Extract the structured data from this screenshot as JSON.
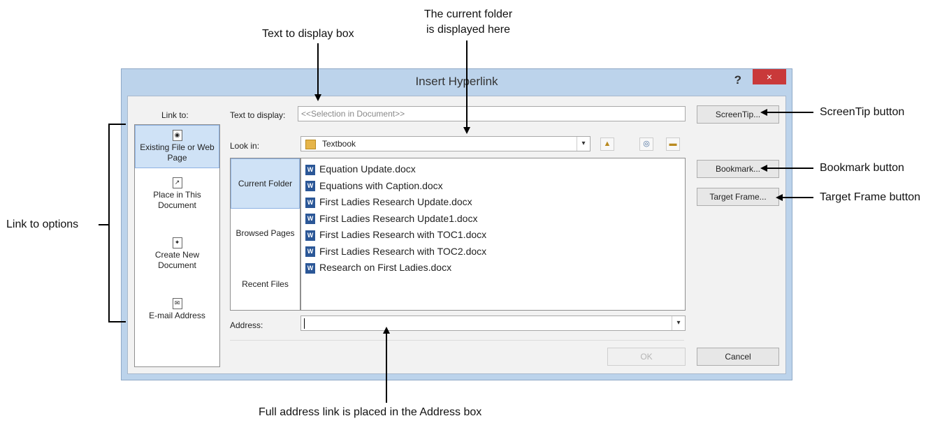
{
  "callouts": {
    "text_to_display": "Text to display box",
    "current_folder": "The current folder\nis displayed here",
    "screentip": "ScreenTip button",
    "bookmark": "Bookmark button",
    "target_frame": "Target Frame button",
    "link_to_options": "Link to options",
    "address": "Full address link is placed in the Address box"
  },
  "dialog": {
    "title": "Insert Hyperlink",
    "help": "?",
    "close": "×",
    "link_to_label": "Link to:",
    "link_items": [
      "Existing File or Web Page",
      "Place in This Document",
      "Create New Document",
      "E-mail Address"
    ],
    "text_to_display_label": "Text to display:",
    "text_to_display_value": "<<Selection in Document>>",
    "look_in_label": "Look in:",
    "look_in_value": "Textbook",
    "view_tabs": [
      "Current Folder",
      "Browsed Pages",
      "Recent Files"
    ],
    "files": [
      "Equation Update.docx",
      "Equations with Caption.docx",
      "First Ladies Research Update.docx",
      "First Ladies Research Update1.docx",
      "First Ladies Research with TOC1.docx",
      "First Ladies Research with TOC2.docx",
      "Research on First Ladies.docx"
    ],
    "address_label": "Address:",
    "address_value": "",
    "buttons": {
      "screentip": "ScreenTip...",
      "bookmark": "Bookmark...",
      "target_frame": "Target Frame...",
      "ok": "OK",
      "cancel": "Cancel"
    }
  }
}
